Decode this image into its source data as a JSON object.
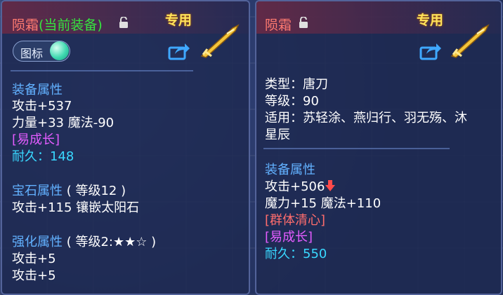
{
  "left_panel": {
    "name": "陨霜",
    "equipped_tag": "(当前装备)",
    "exclusive": "专用",
    "toggle_label": "图标",
    "equip_attr_title": "装备属性",
    "equip_attrs": [
      "攻击+537",
      "力量+33 魔法-90"
    ],
    "growth": "[易成长]",
    "durability": "耐久：148",
    "gem_title": "宝石属性",
    "gem_level": "( 等级12 )",
    "gem_attr": "攻击+115 镶嵌太阳石",
    "enhance_title": "强化属性",
    "enhance_level": "( 等级2:★★☆ )",
    "enhance_attrs": [
      "攻击+5",
      "攻击+5"
    ]
  },
  "right_panel": {
    "name": "陨霜",
    "exclusive": "专用",
    "type": "类型：唐刀",
    "level": "等级：90",
    "applicable_1": "适用：苏轻涂、燕归行、羽无殇、沐",
    "applicable_2": "星辰",
    "equip_attr_title": "装备属性",
    "attack": "攻击+506",
    "attack_trend": "down",
    "attrs": [
      "魔力+15 魔法+110"
    ],
    "special": "[群体清心]",
    "growth": "[易成长]",
    "durability": "耐久：550"
  },
  "colors": {
    "name": "#ff7a70",
    "equipped": "#36e33f",
    "section": "#62b1ff",
    "growth": "#e35cff",
    "durability": "#39d8ff",
    "special": "#ff6d6d",
    "exclusive": "#ffe35a"
  }
}
